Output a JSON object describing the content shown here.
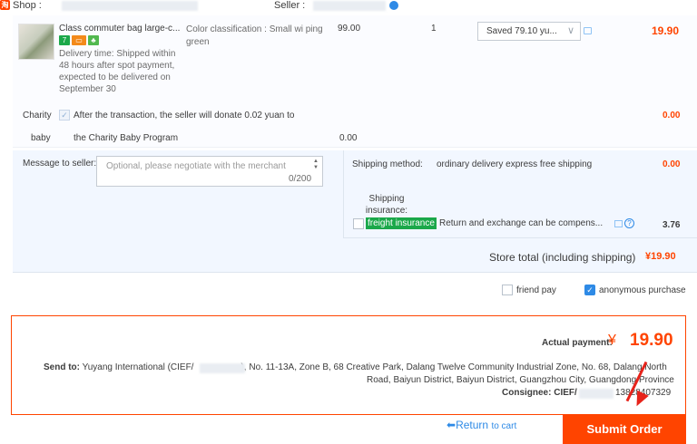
{
  "shop": {
    "logo": "淘",
    "shop_label": "Shop :",
    "seller_label": "Seller :"
  },
  "item": {
    "title": "Class commuter bag large-c...",
    "badge_icons": [
      "7-day-return-icon",
      "card-icon",
      "green-leaf-icon"
    ],
    "delivery": "Delivery time: Shipped within 48 hours after spot payment, expected to be delivered on September 30",
    "color_classification": "Color classification : Small wi ping green",
    "price": "99.00",
    "quantity": "1",
    "discount_selected": "Saved 79.10 yu...",
    "subtotal": "19.90"
  },
  "charity": {
    "label_line1": "Charity",
    "text_line1": "After the transaction, the seller will donate 0.02 yuan to",
    "amount": "0.00",
    "label_line2": "baby",
    "text_line2": "the Charity Baby Program",
    "amount2": "0.00"
  },
  "message": {
    "label": "Message to seller:",
    "placeholder": "Optional, please negotiate with the merchant",
    "count": "0/200"
  },
  "shipping": {
    "label": "Shipping method:",
    "value": "ordinary delivery express free shipping",
    "amount": "0.00",
    "insurance_label": "Shipping insurance:",
    "insurance_highlight": "freight insurance",
    "insurance_text": "Return and exchange can be compens...",
    "insurance_amount": "3.76"
  },
  "store_total": {
    "label": "Store total (including shipping)",
    "amount": "¥19.90"
  },
  "options": {
    "friend_pay": "friend pay",
    "friend_pay_checked": false,
    "anonymous": "anonymous purchase",
    "anonymous_checked": true
  },
  "summary": {
    "actual_label": "Actual payment:",
    "currency": "¥",
    "actual_amount": "19.90",
    "send_to_label": "Send to:",
    "address_part1": "Yuyang International (CIEF/",
    "address_part2": "), No. 11-13A, Zone B, 68 Creative Park, Dalang Twelve Community Industrial Zone, No. 68, Dalang North",
    "address_line2": "Road, Baiyun District, Baiyun District, Guangzhou City, Guangdong Province",
    "consignee_label": "Consignee: CIEF/",
    "consignee_phone": "13828407329"
  },
  "footer": {
    "return_label": "Return",
    "return_suffix": "to cart",
    "submit_label": "Submit Order"
  },
  "colors": {
    "accent": "#ff4400",
    "link": "#2e8ae6",
    "highlight": "#1ba84a"
  }
}
